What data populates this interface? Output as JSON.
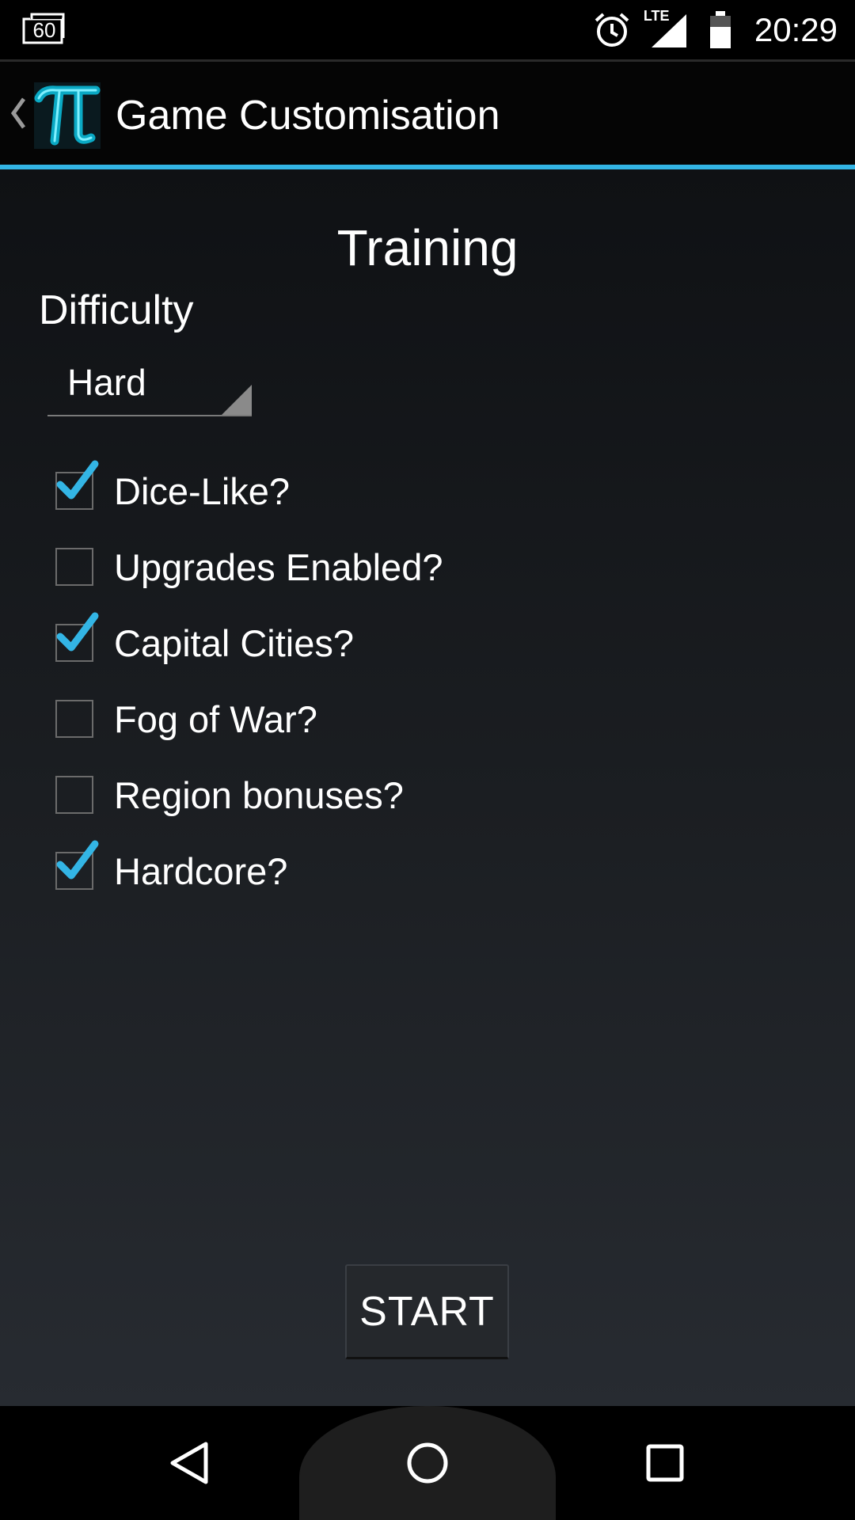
{
  "status_bar": {
    "notification_text": "60",
    "network_label": "LTE",
    "time": "20:29"
  },
  "action_bar": {
    "title": "Game Customisation",
    "app_icon": "pi-icon"
  },
  "main": {
    "mode_title": "Training",
    "difficulty_label": "Difficulty",
    "difficulty_selected": "Hard",
    "options": [
      {
        "label": "Dice-Like?",
        "checked": true
      },
      {
        "label": "Upgrades Enabled?",
        "checked": false
      },
      {
        "label": "Capital Cities?",
        "checked": true
      },
      {
        "label": "Fog of War?",
        "checked": false
      },
      {
        "label": "Region bonuses?",
        "checked": false
      },
      {
        "label": "Hardcore?",
        "checked": true
      }
    ],
    "start_label": "START"
  },
  "colors": {
    "accent": "#33b5e5",
    "background_top": "#0f1114",
    "background_bottom": "#272b31"
  },
  "nav_bar": {
    "icons": [
      "back-icon",
      "home-icon",
      "recents-icon"
    ]
  }
}
